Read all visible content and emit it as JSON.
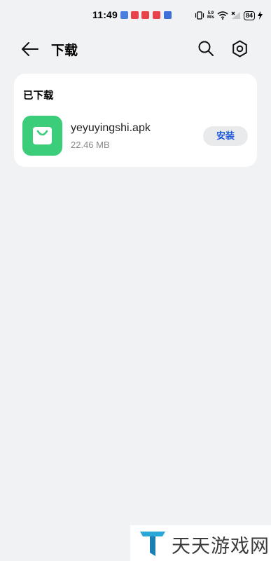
{
  "status_bar": {
    "time": "11:49",
    "net_speed_value": "5.9",
    "net_speed_unit": "M/s",
    "battery": "84",
    "notif_colors": [
      "#4a7fe0",
      "#e8434a",
      "#e8434a",
      "#e8434a",
      "#3f6fd8"
    ]
  },
  "app_bar": {
    "title": "下载",
    "back_icon": "arrow-left-icon",
    "search_icon": "search-icon",
    "settings_icon": "gear-icon"
  },
  "downloaded": {
    "section_title": "已下载",
    "items": [
      {
        "file_name": "yeyuyingshi.apk",
        "size": "22.46 MB",
        "action_label": "安装",
        "icon": "shopping-bag-icon",
        "icon_color": "#3ccd7a"
      }
    ]
  },
  "watermark": {
    "text": "天天游戏网",
    "logo": "tt-logo"
  },
  "colors": {
    "background": "#f1f2f4",
    "card": "#ffffff",
    "accent": "#1a56d9"
  }
}
